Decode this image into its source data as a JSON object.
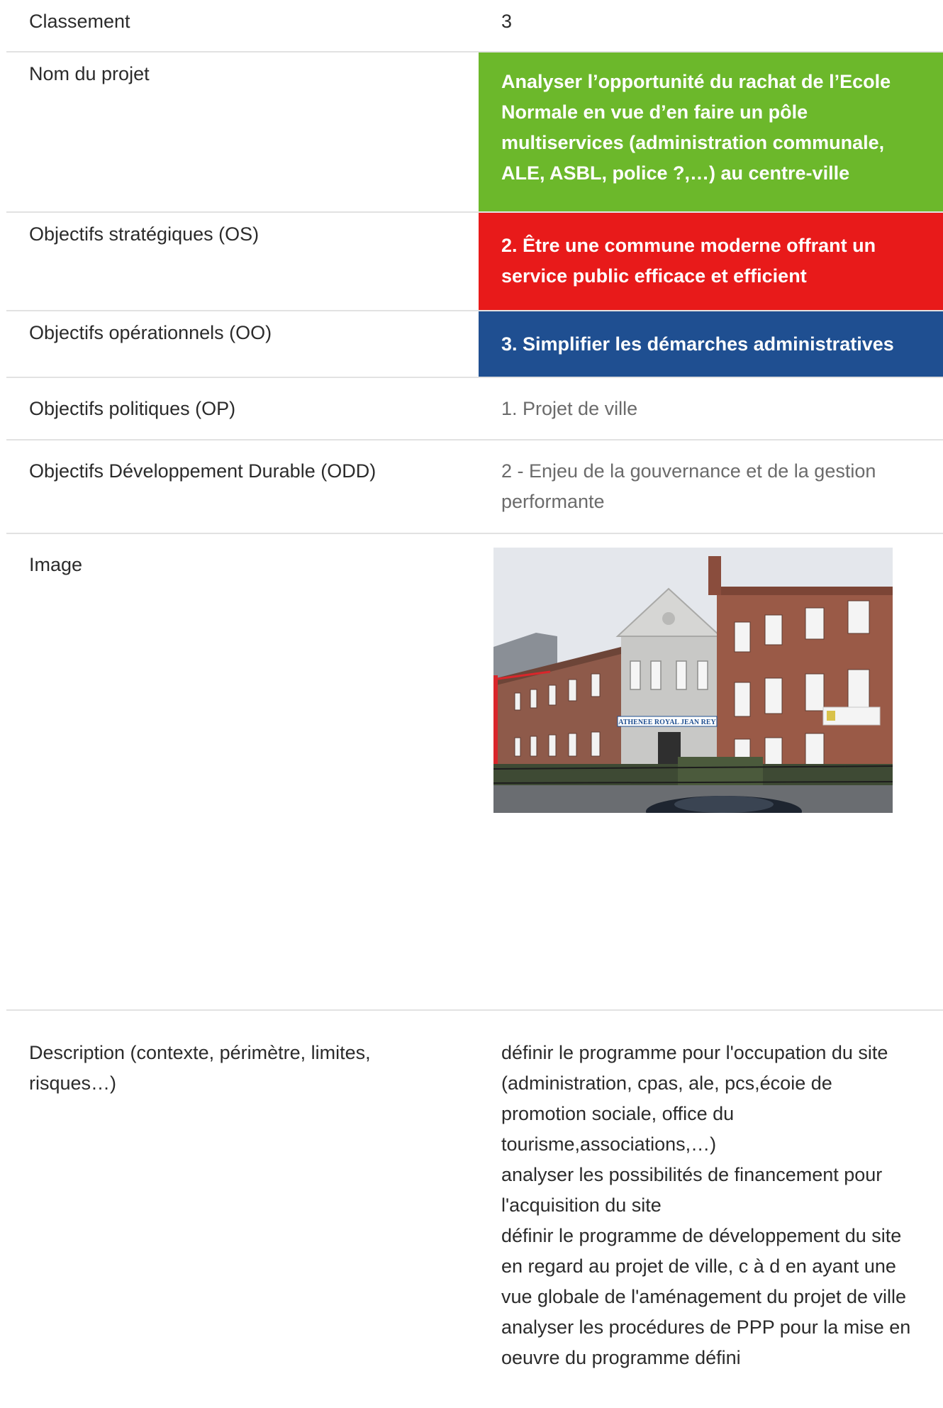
{
  "rows": {
    "classement": {
      "label": "Classement",
      "value": "3"
    },
    "nom": {
      "label": "Nom du projet",
      "value": "Analyser l’opportunité du rachat de l’Ecole Normale en vue d’en faire un pôle multiservices (administration communale, ALE, ASBL, police ?,…) au centre-ville",
      "color": "#6cb82b"
    },
    "os": {
      "label": "Objectifs stratégiques (OS)",
      "value": "2. Être une commune moderne offrant un service public efficace et efficient",
      "color": "#e81a1a"
    },
    "oo": {
      "label": "Objectifs opérationnels (OO)",
      "value": "3. Simplifier les démarches administratives",
      "color": "#1f4f91"
    },
    "op": {
      "label": "Objectifs politiques (OP)",
      "value": "1. Projet de ville"
    },
    "odd": {
      "label": "Objectifs Développement Durable (ODD)",
      "value": "2 - Enjeu de la gouvernance et de la gestion performante"
    },
    "image": {
      "label": "Image",
      "photo_sign": "ATHENEE ROYAL JEAN REY"
    },
    "description": {
      "label": "Description (contexte, périmètre, limites, risques…)",
      "lines": [
        "définir le programme pour l'occupation du site (administration, cpas, ale, pcs,écoie de promotion sociale, office du tourisme,associations,…)",
        "analyser les possibilités de financement pour l'acquisition du site",
        "définir le programme de développement du site en regard au projet de ville, c à d en ayant une vue globale de l'aménagement du projet de ville",
        "analyser les procédures de PPP pour la mise en oeuvre du programme défini"
      ]
    }
  }
}
